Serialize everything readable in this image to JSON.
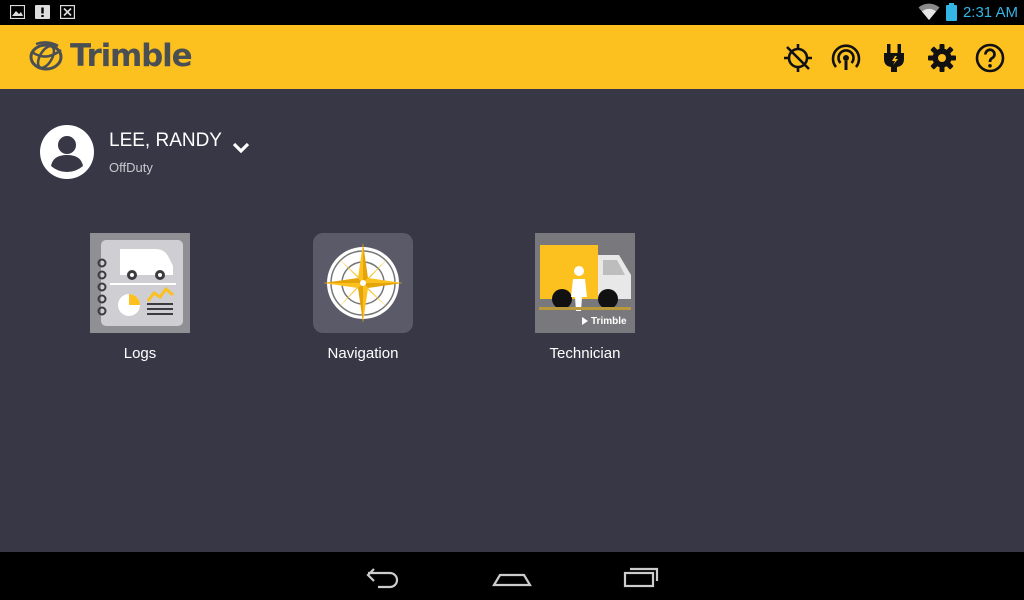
{
  "status_bar": {
    "time": "2:31 AM",
    "left_icons": [
      "image-notification-icon",
      "alert-notification-icon",
      "cancel-notification-icon"
    ],
    "right_icons": [
      "wifi-icon",
      "battery-icon"
    ],
    "time_color": "#33b5e5"
  },
  "header": {
    "brand": "Trimble",
    "background": "#fcc01f",
    "icons": [
      "gps-off-icon",
      "broadcast-icon",
      "power-plug-icon",
      "settings-gear-icon",
      "help-icon"
    ]
  },
  "user": {
    "name": "LEE, RANDY",
    "status": "OffDuty"
  },
  "apps": [
    {
      "label": "Logs",
      "icon": "logs-app-icon"
    },
    {
      "label": "Navigation",
      "icon": "navigation-compass-icon"
    },
    {
      "label": "Technician",
      "icon": "technician-truck-icon",
      "badge": "Trimble"
    }
  ],
  "nav_bar": {
    "buttons": [
      "back-icon",
      "home-icon",
      "recent-apps-icon"
    ]
  },
  "colors": {
    "main_background": "#373745",
    "accent": "#fcc01f"
  }
}
